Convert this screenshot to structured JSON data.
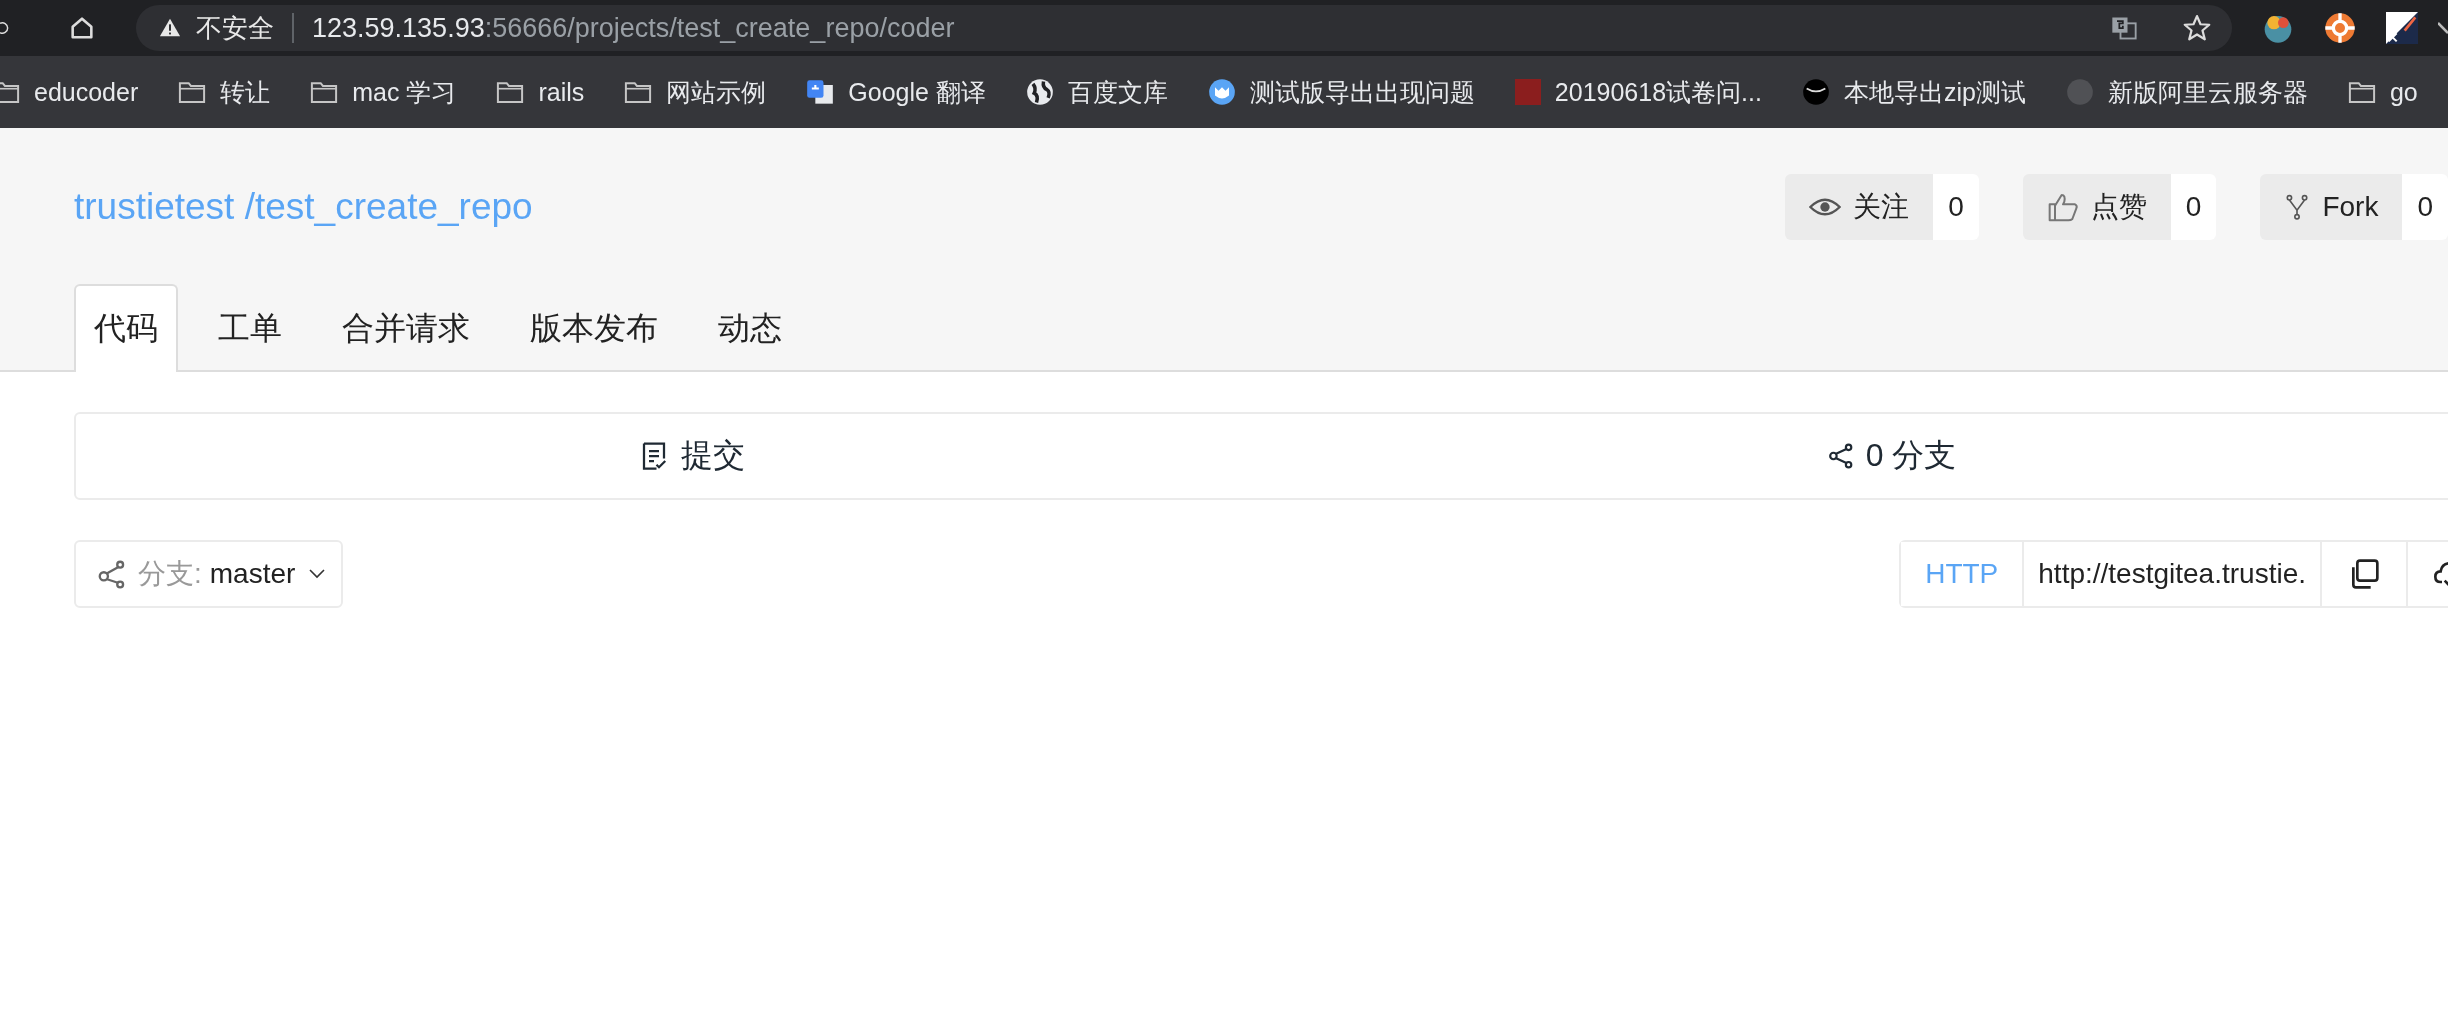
{
  "browser": {
    "security_label": "不安全",
    "url_host": "123.59.135.93",
    "url_rest": ":56666/projects/test_create_repo/coder"
  },
  "bookmarks": [
    {
      "kind": "folder",
      "label": "educoder"
    },
    {
      "kind": "folder",
      "label": "转让"
    },
    {
      "kind": "folder",
      "label": "mac 学习"
    },
    {
      "kind": "folder",
      "label": "rails"
    },
    {
      "kind": "folder",
      "label": "网站示例"
    },
    {
      "kind": "translate",
      "label": "Google 翻译"
    },
    {
      "kind": "globe",
      "label": "百度文库"
    },
    {
      "kind": "badge",
      "label": "测试版导出出现问题"
    },
    {
      "kind": "thumbnail",
      "label": "20190618试卷问..."
    },
    {
      "kind": "dark",
      "label": "本地导出zip测试"
    },
    {
      "kind": "faint",
      "label": "新版阿里云服务器"
    },
    {
      "kind": "folder",
      "label": "go"
    }
  ],
  "repo": {
    "title": "trustietest /test_create_repo"
  },
  "actions": [
    {
      "kind": "watch",
      "label": "关注",
      "count": "0"
    },
    {
      "kind": "like",
      "label": "点赞",
      "count": "0"
    },
    {
      "kind": "fork",
      "label": "Fork",
      "count": "0"
    }
  ],
  "tabs": [
    {
      "label": "代码",
      "selected": true
    },
    {
      "label": "工单",
      "selected": false
    },
    {
      "label": "合并请求",
      "selected": false
    },
    {
      "label": "版本发布",
      "selected": false
    },
    {
      "label": "动态",
      "selected": false
    }
  ],
  "summary": [
    {
      "kind": "commits",
      "label": "提交"
    },
    {
      "kind": "branches",
      "label": "0 分支"
    }
  ],
  "branch": {
    "prefix": "分支:",
    "name": "master"
  },
  "clone": {
    "protocol": "HTTP",
    "url": "http://testgitea.trustie."
  }
}
